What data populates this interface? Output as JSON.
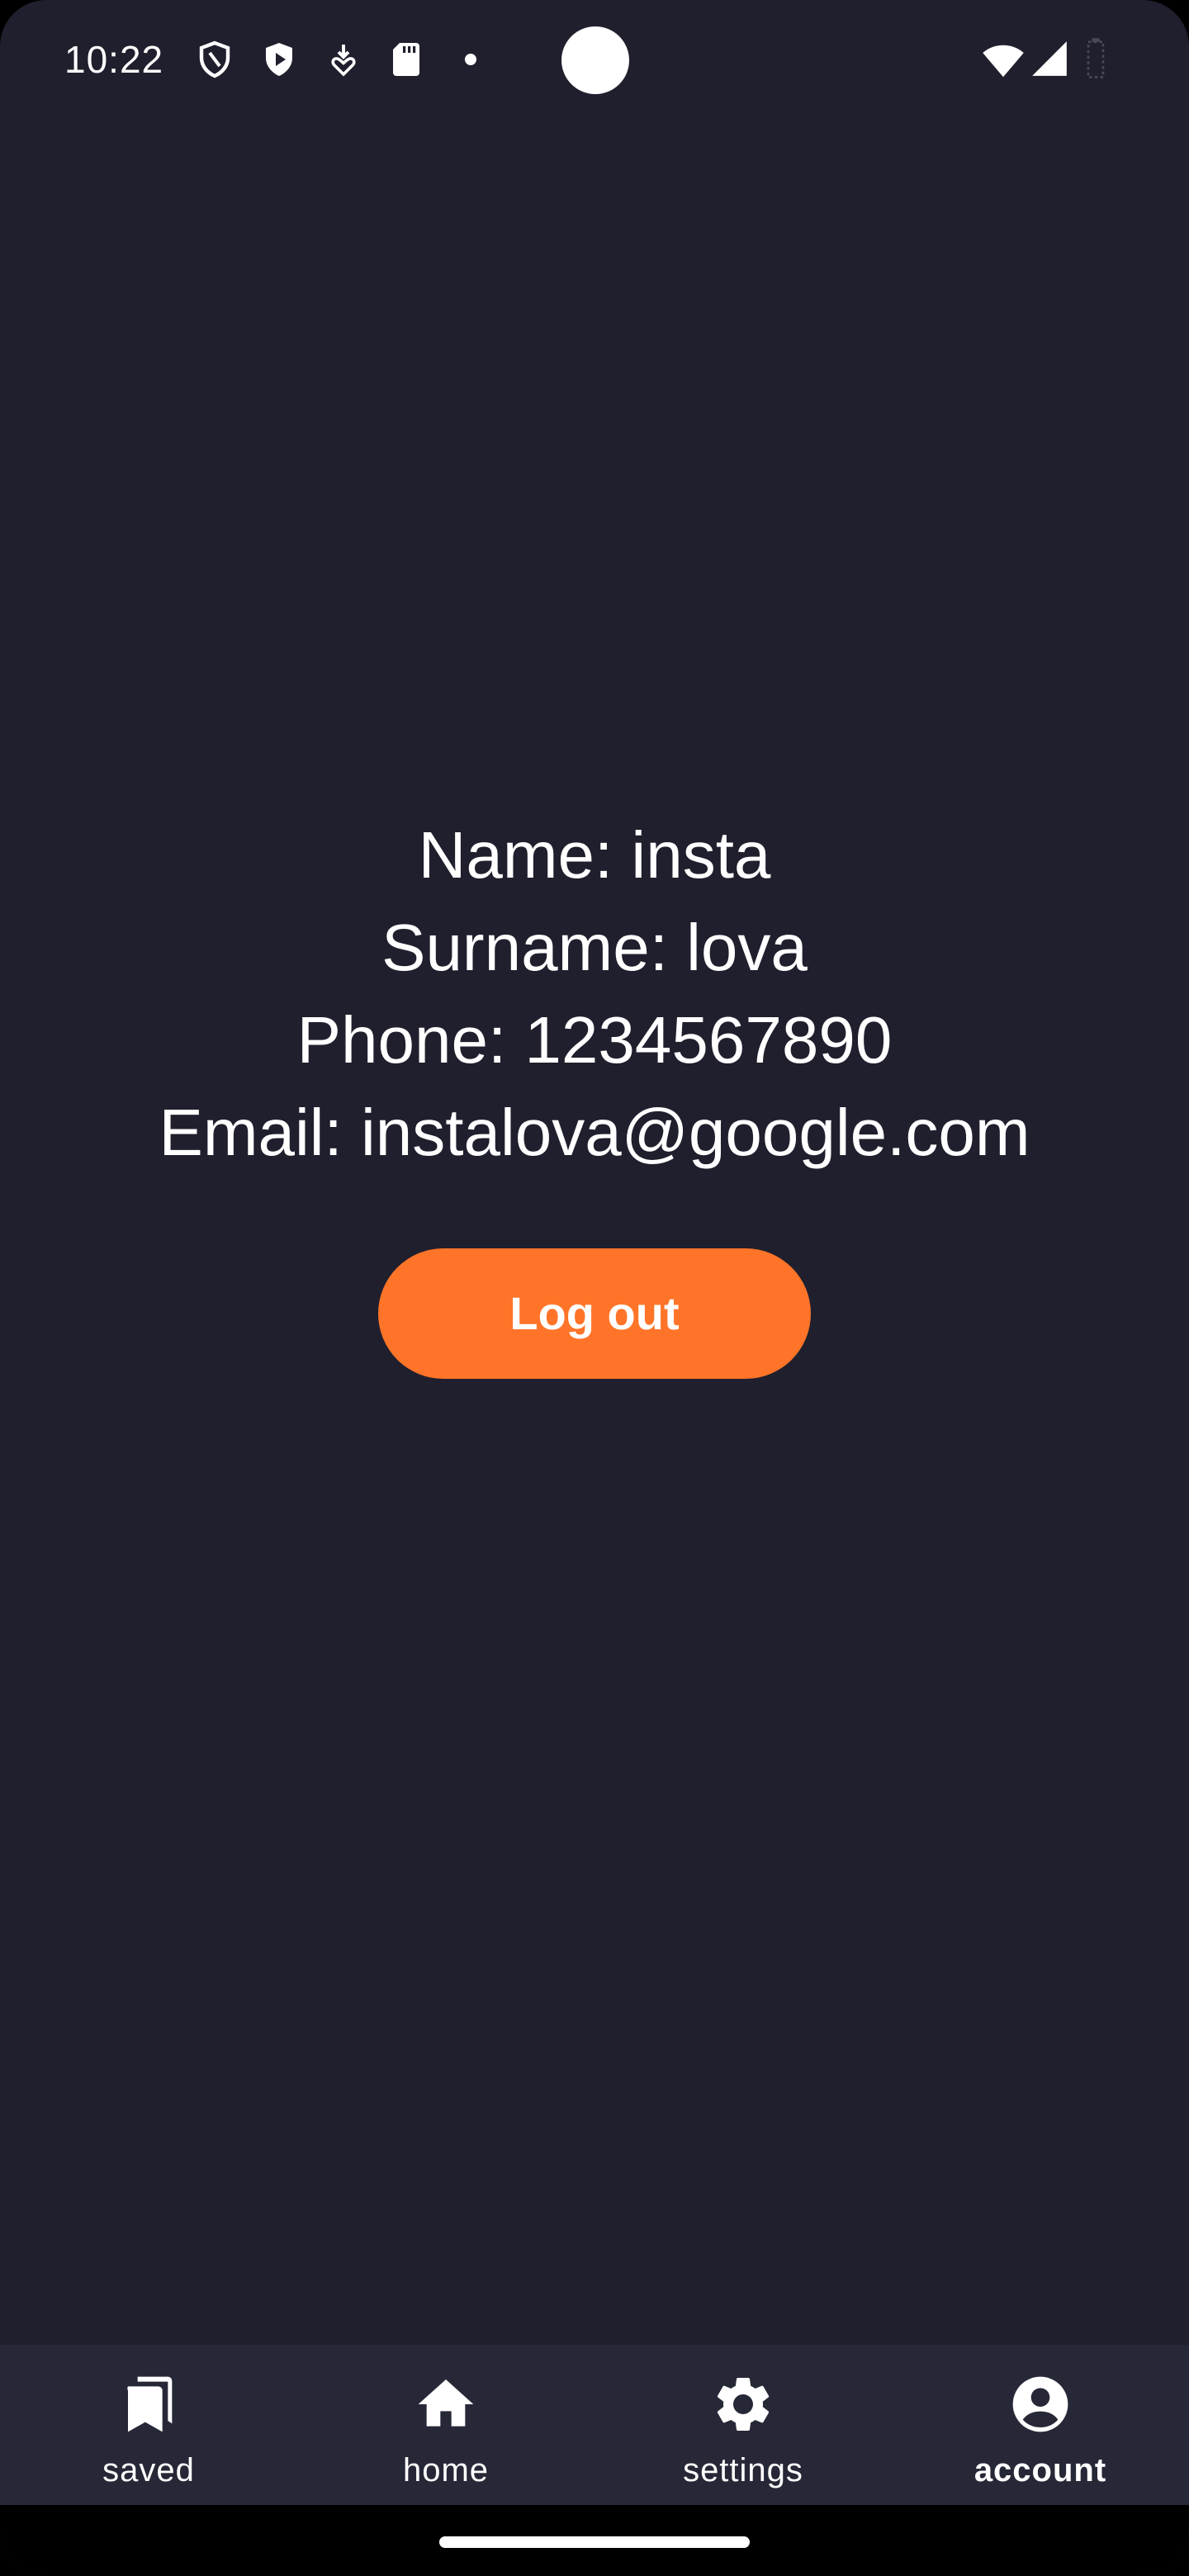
{
  "status_bar": {
    "time": "10:22",
    "icons_left": [
      "shield-outline-icon",
      "shield-play-icon",
      "download-heart-icon",
      "sd-card-icon",
      "dot-icon"
    ],
    "icons_right": [
      "wifi-icon",
      "signal-icon",
      "battery-icon"
    ]
  },
  "profile": {
    "name_line": "Name: insta",
    "surname_line": "Surname: lova",
    "phone_line": "Phone: 1234567890",
    "email_line": "Email: instalova@google.com"
  },
  "logout_label": "Log out",
  "bottom_nav": {
    "items": [
      {
        "label": "saved",
        "icon": "bookmarks-icon",
        "active": false
      },
      {
        "label": "home",
        "icon": "home-icon",
        "active": false
      },
      {
        "label": "settings",
        "icon": "gear-icon",
        "active": false
      },
      {
        "label": "account",
        "icon": "account-circle-icon",
        "active": true
      }
    ]
  },
  "colors": {
    "background": "#201f2d",
    "nav_background": "#272837",
    "accent": "#ff7428",
    "text": "#ffffff"
  }
}
